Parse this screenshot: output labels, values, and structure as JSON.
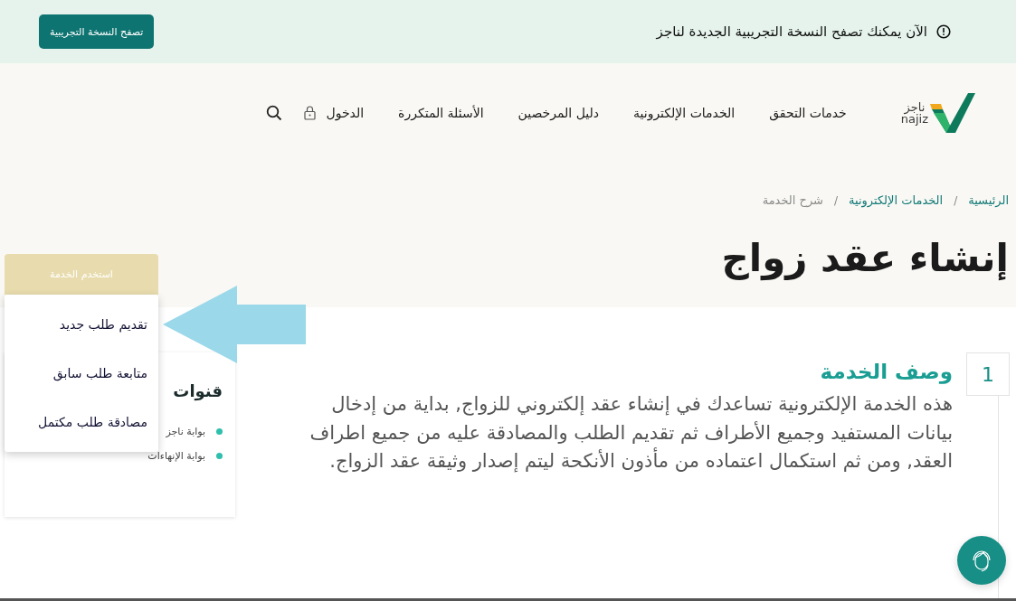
{
  "banner": {
    "message": "الآن يمكنك تصفح النسخة التجريبية الجديدة لناجز",
    "button": "تصفح النسخة التجريبية"
  },
  "header": {
    "logo_text": "ناجز",
    "logo_latin": "najiz",
    "nav": [
      "خدمات التحقق",
      "الخدمات الإلكترونية",
      "دليل المرخصين",
      "الأسئلة المتكررة"
    ],
    "login": "الدخول"
  },
  "breadcrumb": [
    {
      "label": "الرئيسية",
      "current": false
    },
    {
      "separator": "/",
      "label": "الخدمات الإلكترونية",
      "current": false
    },
    {
      "separator": "/",
      "label": "شرح الخدمة",
      "current": true
    }
  ],
  "page_title": "إنشاء عقد زواج",
  "use_service": {
    "button": "استخدم الخدمة",
    "expanded": true,
    "menu": [
      "تقديم طلب جديد",
      "متابعة طلب سابق",
      "مصادقة طلب مكتمل"
    ]
  },
  "section": {
    "number": "1",
    "title": "وصف الخدمة",
    "body": "هذه الخدمة الإلكترونية تساعدك في إنشاء عقد إلكتروني للزواج, بداية من إدخال بيانات المستفيد وجميع الأطراف ثم تقديم الطلب والمصادقة عليه من جميع اطراف العقد, ومن ثم استكمال اعتماده من مأذون الأنكحة ليتم إصدار وثيقة عقد الزواج."
  },
  "channels": {
    "title": "قنوات",
    "items": [
      "بوابة ناجز",
      "بوابة الإنهاءات"
    ]
  }
}
